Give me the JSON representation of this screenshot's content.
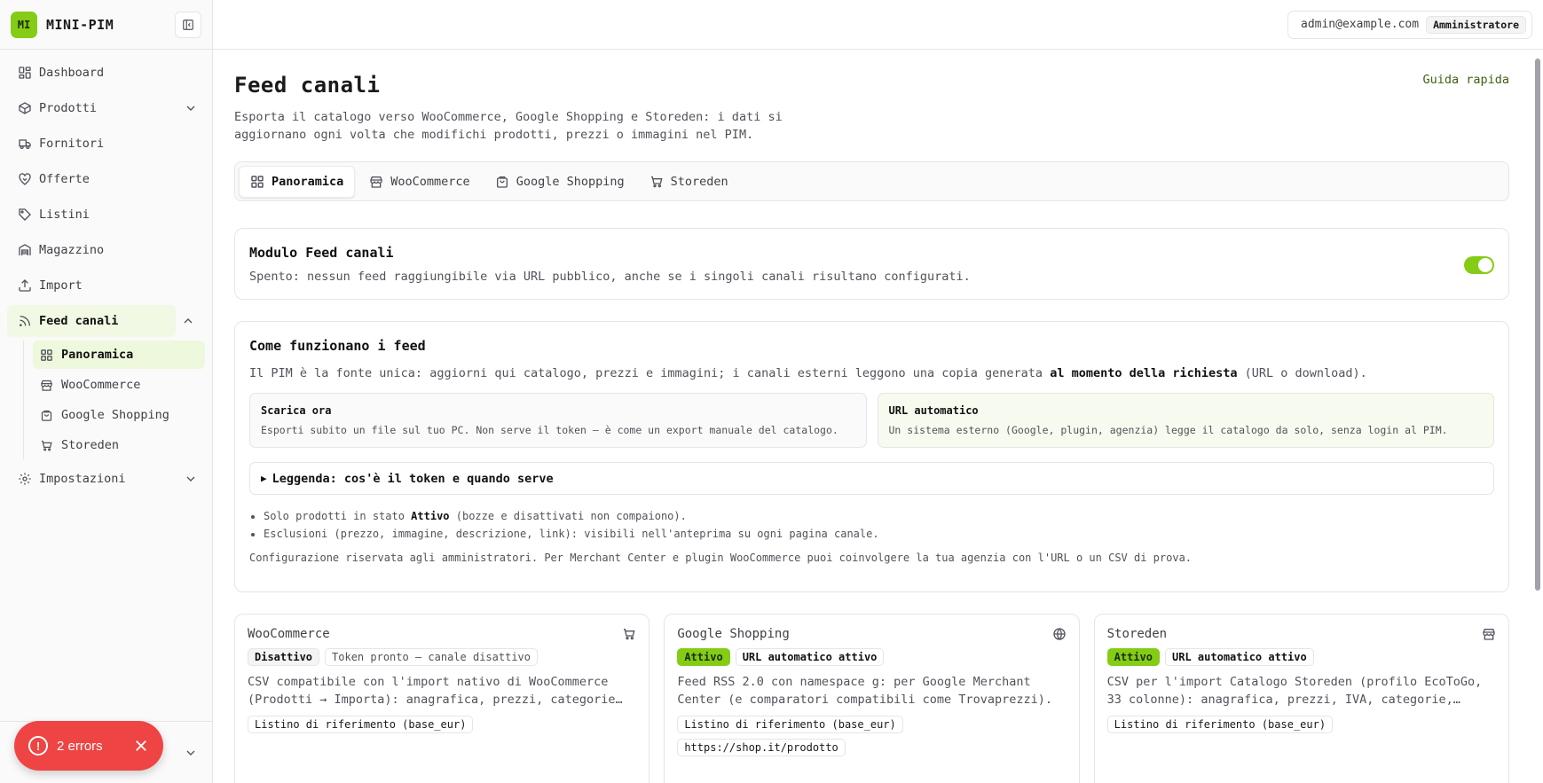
{
  "brand": {
    "logo": "MI",
    "name": "MINI-PIM"
  },
  "header": {
    "user_email": "admin@example.com",
    "role": "Amministratore"
  },
  "sidebar": {
    "items": [
      {
        "label": "Dashboard",
        "icon": "dashboard-icon"
      },
      {
        "label": "Prodotti",
        "icon": "box-icon",
        "expandable": true
      },
      {
        "label": "Fornitori",
        "icon": "truck-icon"
      },
      {
        "label": "Offerte",
        "icon": "handshake-icon"
      },
      {
        "label": "Listini",
        "icon": "tag-icon"
      },
      {
        "label": "Magazzino",
        "icon": "warehouse-icon"
      },
      {
        "label": "Import",
        "icon": "upload-icon"
      },
      {
        "label": "Feed canali",
        "icon": "rss-icon",
        "active": true,
        "expanded": true
      },
      {
        "label": "Impostazioni",
        "icon": "gear-icon",
        "expandable": true
      }
    ],
    "subitems": [
      {
        "label": "Panoramica",
        "icon": "grid-icon",
        "active": true
      },
      {
        "label": "WooCommerce",
        "icon": "store-icon"
      },
      {
        "label": "Google Shopping",
        "icon": "shopping-bag-icon"
      },
      {
        "label": "Storeden",
        "icon": "cart-icon"
      }
    ]
  },
  "toast": {
    "label": "2 errors"
  },
  "page": {
    "title": "Feed canali",
    "guide_link": "Guida rapida",
    "description": "Esporta il catalogo verso WooCommerce, Google Shopping e Storeden: i dati si aggiornano ogni volta che modifichi prodotti, prezzi o immagini nel PIM."
  },
  "tabs": [
    {
      "label": "Panoramica",
      "active": true
    },
    {
      "label": "WooCommerce"
    },
    {
      "label": "Google Shopping"
    },
    {
      "label": "Storeden"
    }
  ],
  "module": {
    "title": "Modulo Feed canali",
    "description": "Spento: nessun feed raggiungibile via URL pubblico, anche se i singoli canali risultano configurati.",
    "toggle_on": true
  },
  "how": {
    "title": "Come funzionano i feed",
    "intro_pre": "Il PIM è la fonte unica: aggiorni qui catalogo, prezzi e immagini; i canali esterni leggono una copia generata ",
    "intro_bold": "al momento della richiesta",
    "intro_post": " (URL o download).",
    "box_download_title": "Scarica ora",
    "box_download_text": "Esporti subito un file sul tuo PC. Non serve il token — è come un export manuale del catalogo.",
    "box_url_title": "URL automatico",
    "box_url_text": "Un sistema esterno (Google, plugin, agenzia) legge il catalogo da solo, senza login al PIM.",
    "legend": "Leggenda: cos'è il token e quando serve",
    "bullet1_pre": "Solo prodotti in stato ",
    "bullet1_bold": "Attivo",
    "bullet1_post": " (bozze e disattivati non compaiono).",
    "bullet2": "Esclusioni (prezzo, immagine, descrizione, link): visibili nell'anteprima su ogni pagina canale.",
    "note": "Configurazione riservata agli amministratori. Per Merchant Center e plugin WooCommerce puoi coinvolgere la tua agenzia con l'URL o un CSV di prova."
  },
  "channels": [
    {
      "name": "WooCommerce",
      "icon": "cart-icon",
      "status": "Disattivo",
      "info": "Token pronto — canale disattivo",
      "description": "CSV compatibile con l'import nativo di WooCommerce (Prodotti → Importa): anagrafica, prezzi, categorie…",
      "chips": [
        "Listino di riferimento (base_eur)"
      ]
    },
    {
      "name": "Google Shopping",
      "icon": "globe-icon",
      "status": "Attivo",
      "info": "URL automatico attivo",
      "description": "Feed RSS 2.0 con namespace g: per Google Merchant Center (e comparatori compatibili come Trovaprezzi).",
      "chips": [
        "Listino di riferimento (base_eur)",
        "https://shop.it/prodotto"
      ]
    },
    {
      "name": "Storeden",
      "icon": "store-icon",
      "status": "Attivo",
      "info": "URL automatico attivo",
      "description": "CSV per l'import Catalogo Storeden (profilo EcoToGo, 33 colonne): anagrafica, prezzi, IVA, categorie,…",
      "chips": [
        "Listino di riferimento (base_eur)"
      ]
    }
  ],
  "colors": {
    "accent": "#84cc16",
    "error": "#ef4444",
    "link": "#3f6212"
  }
}
